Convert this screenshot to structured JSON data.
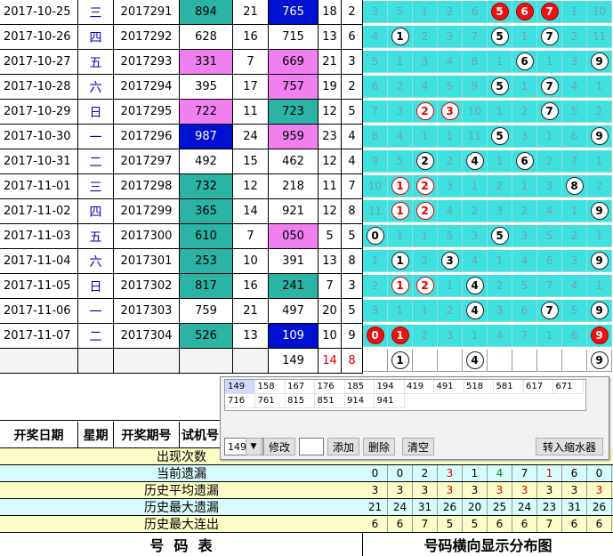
{
  "draws": [
    {
      "date": "2017-10-25",
      "weekday": "三",
      "issue": "2017291",
      "test": "894",
      "sum1": "21",
      "win": "765",
      "sum2": "18",
      "span": "2",
      "test_bg": "teal",
      "win_bg": "blue",
      "dist": [
        {
          "t": "3"
        },
        {
          "t": "5"
        },
        {
          "t": "1"
        },
        {
          "t": "2"
        },
        {
          "t": "6"
        },
        {
          "t": "5",
          "b": "r"
        },
        {
          "t": "6",
          "b": "r"
        },
        {
          "t": "7",
          "b": "r"
        },
        {
          "t": "1"
        },
        {
          "t": "10"
        }
      ]
    },
    {
      "date": "2017-10-26",
      "weekday": "四",
      "issue": "2017292",
      "test": "628",
      "sum1": "16",
      "win": "715",
      "sum2": "13",
      "span": "6",
      "test_bg": "",
      "win_bg": "",
      "dist": [
        {
          "t": "4"
        },
        {
          "t": "1",
          "b": "w"
        },
        {
          "t": "2"
        },
        {
          "t": "3"
        },
        {
          "t": "7"
        },
        {
          "t": "5",
          "b": "w"
        },
        {
          "t": "1"
        },
        {
          "t": "7",
          "b": "w"
        },
        {
          "t": "2"
        },
        {
          "t": "11"
        }
      ]
    },
    {
      "date": "2017-10-27",
      "weekday": "五",
      "issue": "2017293",
      "test": "331",
      "sum1": "7",
      "win": "669",
      "sum2": "21",
      "span": "3",
      "test_bg": "pink",
      "win_bg": "pink",
      "dist": [
        {
          "t": "5"
        },
        {
          "t": "1"
        },
        {
          "t": "3"
        },
        {
          "t": "4"
        },
        {
          "t": "8"
        },
        {
          "t": "1"
        },
        {
          "t": "6",
          "b": "w"
        },
        {
          "t": "1"
        },
        {
          "t": "3"
        },
        {
          "t": "9",
          "b": "w"
        }
      ]
    },
    {
      "date": "2017-10-28",
      "weekday": "六",
      "issue": "2017294",
      "test": "395",
      "sum1": "17",
      "win": "757",
      "sum2": "19",
      "span": "2",
      "test_bg": "",
      "win_bg": "pink",
      "dist": [
        {
          "t": "6"
        },
        {
          "t": "2"
        },
        {
          "t": "4"
        },
        {
          "t": "5"
        },
        {
          "t": "9"
        },
        {
          "t": "5",
          "b": "w"
        },
        {
          "t": "1"
        },
        {
          "t": "7",
          "b": "w"
        },
        {
          "t": "4"
        },
        {
          "t": "1"
        }
      ]
    },
    {
      "date": "2017-10-29",
      "weekday": "日",
      "issue": "2017295",
      "test": "722",
      "sum1": "11",
      "win": "723",
      "sum2": "12",
      "span": "5",
      "test_bg": "pink",
      "win_bg": "teal",
      "dist": [
        {
          "t": "7"
        },
        {
          "t": "3"
        },
        {
          "t": "2",
          "b": "r2"
        },
        {
          "t": "3",
          "b": "r2"
        },
        {
          "t": "10"
        },
        {
          "t": "1"
        },
        {
          "t": "2"
        },
        {
          "t": "7",
          "b": "w"
        },
        {
          "t": "5"
        },
        {
          "t": "2"
        }
      ]
    },
    {
      "date": "2017-10-30",
      "weekday": "一",
      "issue": "2017296",
      "test": "987",
      "sum1": "24",
      "win": "959",
      "sum2": "23",
      "span": "4",
      "test_bg": "blue",
      "win_bg": "pink",
      "dist": [
        {
          "t": "8"
        },
        {
          "t": "4"
        },
        {
          "t": "1"
        },
        {
          "t": "1"
        },
        {
          "t": "11"
        },
        {
          "t": "5",
          "b": "w"
        },
        {
          "t": "3"
        },
        {
          "t": "1"
        },
        {
          "t": "6"
        },
        {
          "t": "9",
          "b": "w"
        }
      ]
    },
    {
      "date": "2017-10-31",
      "weekday": "二",
      "issue": "2017297",
      "test": "492",
      "sum1": "15",
      "win": "462",
      "sum2": "12",
      "span": "4",
      "test_bg": "",
      "win_bg": "",
      "dist": [
        {
          "t": "9"
        },
        {
          "t": "5"
        },
        {
          "t": "2",
          "b": "w"
        },
        {
          "t": "2"
        },
        {
          "t": "4",
          "b": "w"
        },
        {
          "t": "1"
        },
        {
          "t": "6",
          "b": "w"
        },
        {
          "t": "2"
        },
        {
          "t": "7"
        },
        {
          "t": "1"
        }
      ]
    },
    {
      "date": "2017-11-01",
      "weekday": "三",
      "issue": "2017298",
      "test": "732",
      "sum1": "12",
      "win": "218",
      "sum2": "11",
      "span": "7",
      "test_bg": "teal",
      "win_bg": "",
      "dist": [
        {
          "t": "10"
        },
        {
          "t": "1",
          "b": "rt"
        },
        {
          "t": "2",
          "b": "rt"
        },
        {
          "t": "3"
        },
        {
          "t": "1"
        },
        {
          "t": "2"
        },
        {
          "t": "1"
        },
        {
          "t": "3"
        },
        {
          "t": "8",
          "b": "w"
        },
        {
          "t": "2"
        }
      ]
    },
    {
      "date": "2017-11-02",
      "weekday": "四",
      "issue": "2017299",
      "test": "365",
      "sum1": "14",
      "win": "921",
      "sum2": "12",
      "span": "8",
      "test_bg": "teal",
      "win_bg": "",
      "dist": [
        {
          "t": "11"
        },
        {
          "t": "1",
          "b": "rt"
        },
        {
          "t": "2",
          "b": "rt"
        },
        {
          "t": "4"
        },
        {
          "t": "2"
        },
        {
          "t": "3"
        },
        {
          "t": "2"
        },
        {
          "t": "4"
        },
        {
          "t": "1"
        },
        {
          "t": "9",
          "b": "w"
        }
      ]
    },
    {
      "date": "2017-11-03",
      "weekday": "五",
      "issue": "2017300",
      "test": "610",
      "sum1": "7",
      "win": "050",
      "sum2": "5",
      "span": "5",
      "test_bg": "teal",
      "win_bg": "pink",
      "dist": [
        {
          "t": "0",
          "b": "w"
        },
        {
          "t": "1"
        },
        {
          "t": "1"
        },
        {
          "t": "5"
        },
        {
          "t": "3"
        },
        {
          "t": "5",
          "b": "w"
        },
        {
          "t": "3"
        },
        {
          "t": "5"
        },
        {
          "t": "2"
        },
        {
          "t": "1"
        }
      ]
    },
    {
      "date": "2017-11-04",
      "weekday": "六",
      "issue": "2017301",
      "test": "253",
      "sum1": "10",
      "win": "391",
      "sum2": "13",
      "span": "8",
      "test_bg": "teal",
      "win_bg": "",
      "dist": [
        {
          "t": "1"
        },
        {
          "t": "1",
          "b": "w"
        },
        {
          "t": "2"
        },
        {
          "t": "3",
          "b": "w"
        },
        {
          "t": "4"
        },
        {
          "t": "1"
        },
        {
          "t": "4"
        },
        {
          "t": "6"
        },
        {
          "t": "3"
        },
        {
          "t": "9",
          "b": "w"
        }
      ]
    },
    {
      "date": "2017-11-05",
      "weekday": "日",
      "issue": "2017302",
      "test": "817",
      "sum1": "16",
      "win": "241",
      "sum2": "7",
      "span": "3",
      "test_bg": "teal",
      "win_bg": "teal",
      "dist": [
        {
          "t": "2"
        },
        {
          "t": "1",
          "b": "rt"
        },
        {
          "t": "2",
          "b": "rt"
        },
        {
          "t": "1"
        },
        {
          "t": "4",
          "b": "w"
        },
        {
          "t": "2"
        },
        {
          "t": "5"
        },
        {
          "t": "7"
        },
        {
          "t": "4"
        },
        {
          "t": "1"
        }
      ]
    },
    {
      "date": "2017-11-06",
      "weekday": "一",
      "issue": "2017303",
      "test": "759",
      "sum1": "21",
      "win": "497",
      "sum2": "20",
      "span": "5",
      "test_bg": "",
      "win_bg": "",
      "dist": [
        {
          "t": "3"
        },
        {
          "t": "1"
        },
        {
          "t": "1"
        },
        {
          "t": "2"
        },
        {
          "t": "4",
          "b": "w"
        },
        {
          "t": "3"
        },
        {
          "t": "6"
        },
        {
          "t": "7",
          "b": "w"
        },
        {
          "t": "5"
        },
        {
          "t": "9",
          "b": "w"
        }
      ]
    },
    {
      "date": "2017-11-07",
      "weekday": "二",
      "issue": "2017304",
      "test": "526",
      "sum1": "13",
      "win": "109",
      "sum2": "10",
      "span": "9",
      "test_bg": "teal",
      "win_bg": "blue",
      "dist": [
        {
          "t": "0",
          "b": "r"
        },
        {
          "t": "1",
          "b": "r"
        },
        {
          "t": "2"
        },
        {
          "t": "3"
        },
        {
          "t": "1"
        },
        {
          "t": "4"
        },
        {
          "t": "7"
        },
        {
          "t": "1"
        },
        {
          "t": "6"
        },
        {
          "t": "9",
          "b": "r"
        }
      ]
    }
  ],
  "forecast_row": {
    "win": "149",
    "sum2": "14",
    "span": "8",
    "dist": [
      {
        "t": ""
      },
      {
        "t": "1",
        "b": "w"
      },
      {
        "t": ""
      },
      {
        "t": ""
      },
      {
        "t": "4",
        "b": "w"
      },
      {
        "t": ""
      },
      {
        "t": ""
      },
      {
        "t": ""
      },
      {
        "t": ""
      },
      {
        "t": "9",
        "b": "w"
      }
    ]
  },
  "header": {
    "date": "开奖日期",
    "weekday": "星期",
    "issue": "开奖期号",
    "test": "试机号"
  },
  "stats": [
    {
      "label": "出现次数",
      "values": [],
      "bg": "#fdfdc8"
    },
    {
      "label": "当前遗漏",
      "values": [
        "0",
        "0",
        "2",
        "3",
        "1",
        "4",
        "7",
        "1",
        "6",
        "0"
      ],
      "colors": [
        "",
        "",
        "",
        "#e00000",
        "",
        "#0a8a0a",
        "",
        "#e00000",
        "",
        ""
      ],
      "bg": "#d6fbfb"
    },
    {
      "label": "历史平均遗漏",
      "values": [
        "3",
        "3",
        "3",
        "3",
        "3",
        "3",
        "3",
        "3",
        "3",
        "3"
      ],
      "colors": [
        "",
        "",
        "",
        "#e00000",
        "",
        "#e00000",
        "#e00000",
        "",
        "",
        "#e00000"
      ],
      "bg": "#fdfdc8"
    },
    {
      "label": "历史最大遗漏",
      "values": [
        "21",
        "24",
        "31",
        "26",
        "20",
        "25",
        "24",
        "23",
        "31",
        "26"
      ],
      "bg": "#d6fbfb"
    },
    {
      "label": "历史最大连出",
      "values": [
        "6",
        "6",
        "7",
        "5",
        "5",
        "6",
        "6",
        "7",
        "6",
        "6"
      ],
      "bg": "#fdfdc8"
    }
  ],
  "footer": {
    "left": "号  码  表",
    "right": "号码横向显示分布图"
  },
  "popup": {
    "numbers": [
      "149",
      "158",
      "167",
      "176",
      "185",
      "194",
      "419",
      "491",
      "518",
      "581",
      "617",
      "671",
      "716",
      "761",
      "815",
      "851",
      "914",
      "941"
    ],
    "selected": "149",
    "combo_value": "149",
    "modify_label": "修改",
    "add_label": "添加",
    "delete_label": "删除",
    "clear_label": "清空",
    "transfer_label": "转入缩水器"
  },
  "colors": {
    "teal": "#2bb3a3",
    "pink": "#f07ff0",
    "blue": "#0010d0",
    "grid_bg": "#3fe0e0",
    "red_ball": "#ee1010"
  }
}
